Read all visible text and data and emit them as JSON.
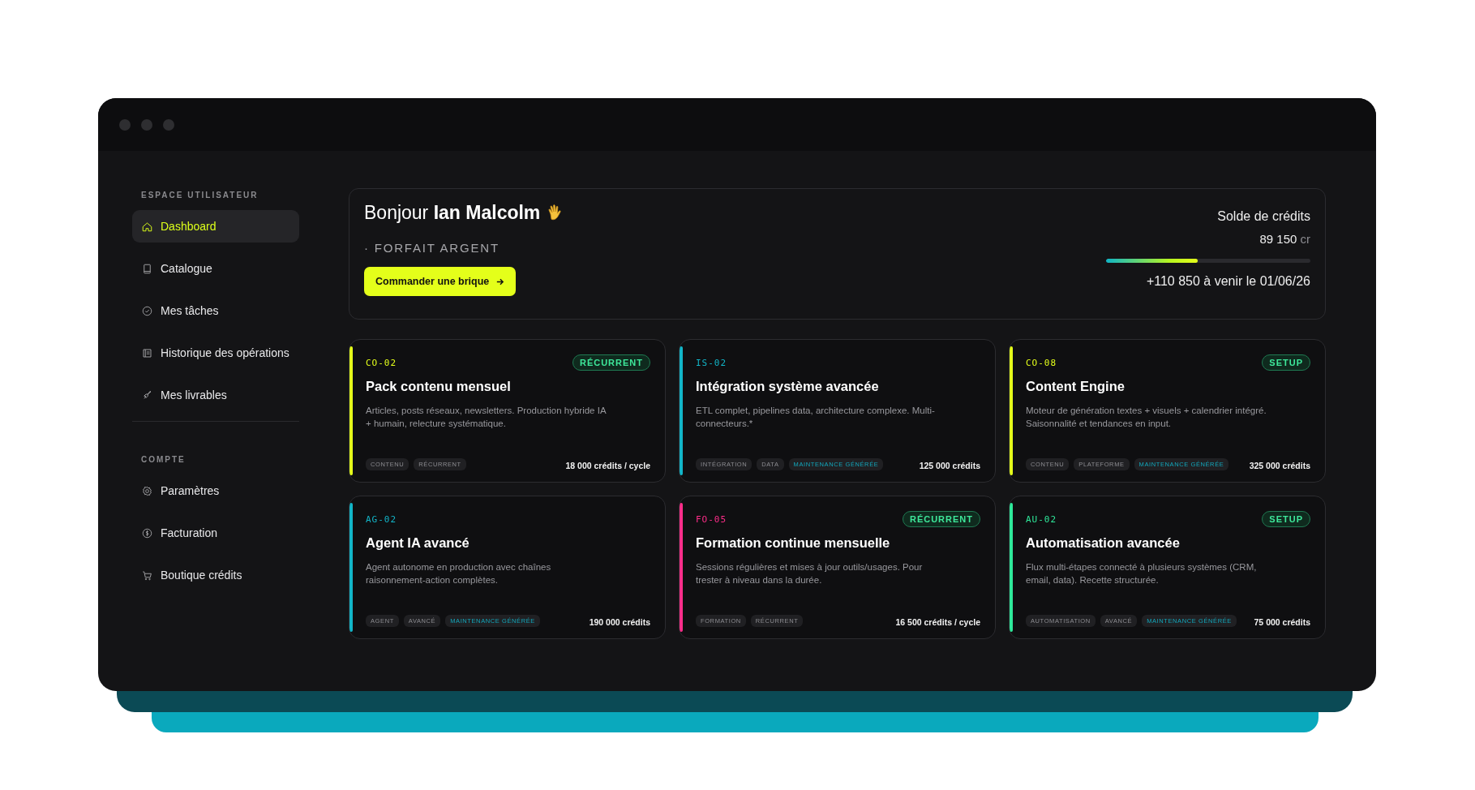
{
  "sidebar": {
    "sections": [
      {
        "title": "ESPACE UTILISATEUR",
        "items": [
          {
            "label": "Dashboard",
            "selected": true
          },
          {
            "label": "Catalogue",
            "selected": false
          },
          {
            "label": "Mes tâches",
            "selected": false
          },
          {
            "label": "Historique des opérations",
            "selected": false
          },
          {
            "label": "Mes livrables",
            "selected": false
          }
        ]
      },
      {
        "title": "COMPTE",
        "items": [
          {
            "label": "Paramètres",
            "selected": false
          },
          {
            "label": "Facturation",
            "selected": false
          },
          {
            "label": "Boutique crédits",
            "selected": false
          }
        ]
      }
    ]
  },
  "header": {
    "greeting": "Bonjour **Ian Malcolm**",
    "plan": "· FORFAIT ARGENT",
    "button": "Commander une brique",
    "balance_label": "Solde de crédits",
    "balance": "89 150",
    "unit": "cr",
    "level": 0.45,
    "upcoming": "+110 850 à venir le 01/06/26"
  },
  "cards": [
    {
      "code": "CO-02",
      "color": "#e4ff1a",
      "badge": "RÉCURRENT",
      "title": "Pack contenu mensuel",
      "description": "Articles, posts réseaux, newsletters. Production hybride IA + humain, relecture systématique.",
      "tags": [
        {
          "label": "CONTENU",
          "kind": "plain"
        },
        {
          "label": "RÉCURRENT",
          "kind": "plain"
        }
      ],
      "price": "18 000 crédits / cycle"
    },
    {
      "code": "IS-02",
      "color": "#12b5c8",
      "title": "Intégration système avancée",
      "description": "ETL complet, pipelines data, architecture complexe. Multi-connecteurs.*",
      "tags": [
        {
          "label": "INTÉGRATION",
          "kind": "plain"
        },
        {
          "label": "DATA",
          "kind": "plain"
        },
        {
          "label": "MAINTENANCE GÉNÉRÉE",
          "kind": "highlight"
        }
      ],
      "price": "125 000 crédits"
    },
    {
      "code": "CO-08",
      "color": "#e4ff1a",
      "badge": "SETUP",
      "title": "Content Engine",
      "description": "Moteur de génération textes + visuels + calendrier intégré. Saisonnalité et tendances en input.",
      "tags": [
        {
          "label": "CONTENU",
          "kind": "plain"
        },
        {
          "label": "PLATEFORME",
          "kind": "plain"
        },
        {
          "label": "MAINTENANCE GÉNÉRÉE",
          "kind": "highlight"
        }
      ],
      "price": "325 000 crédits"
    },
    {
      "code": "AG-02",
      "color": "#12b5c8",
      "title": "Agent IA avancé",
      "description": "Agent autonome en production avec chaînes raisonnement-action complètes.",
      "tags": [
        {
          "label": "AGENT",
          "kind": "plain"
        },
        {
          "label": "AVANCÉ",
          "kind": "plain"
        },
        {
          "label": "MAINTENANCE GÉNÉRÉE",
          "kind": "highlight"
        }
      ],
      "price": "190 000 crédits"
    },
    {
      "code": "FO-05",
      "color": "#ff2d8a",
      "badge": "RÉCURRENT",
      "title": "Formation continue mensuelle",
      "description": "Sessions régulières et mises à jour outils/usages. Pour trester à niveau dans la durée.",
      "tags": [
        {
          "label": "FORMATION",
          "kind": "plain"
        },
        {
          "label": "RÉCURRENT",
          "kind": "plain"
        }
      ],
      "price": "16 500 crédits / cycle"
    },
    {
      "code": "AU-02",
      "color": "#2ee89a",
      "badge": "SETUP",
      "title": "Automatisation avancée",
      "description": "Flux multi-étapes connecté à plusieurs systèmes (CRM, email, data). Recette structurée.",
      "tags": [
        {
          "label": "AUTOMATISATION",
          "kind": "plain"
        },
        {
          "label": "AVANCÉ",
          "kind": "plain"
        },
        {
          "label": "MAINTENANCE GÉNÉRÉE",
          "kind": "highlight"
        }
      ],
      "price": "75 000 crédits"
    }
  ]
}
